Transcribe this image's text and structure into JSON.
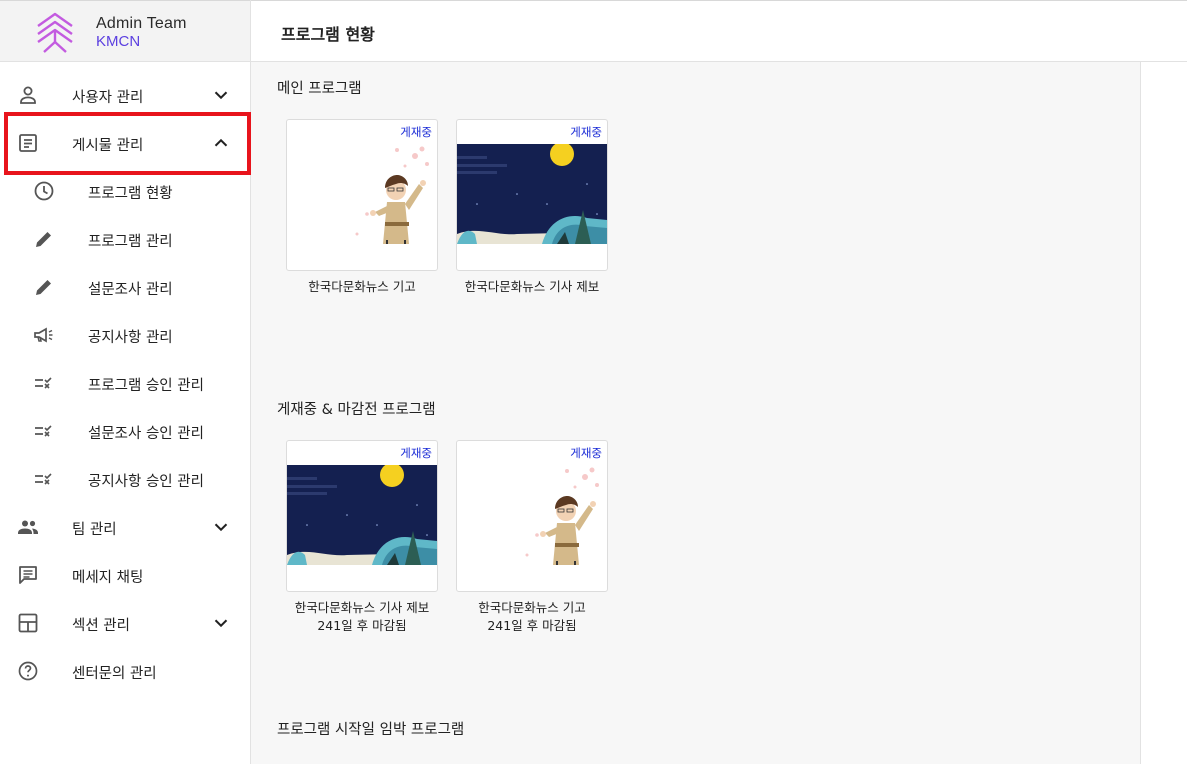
{
  "brand": {
    "line1": "Admin Team",
    "line2": "KMCN"
  },
  "header": {
    "title": "프로그램 현황"
  },
  "sidebar": {
    "items": [
      {
        "label": "사용자 관리",
        "icon": "person-icon",
        "chevron": "down"
      },
      {
        "label": "게시물 관리",
        "icon": "article-icon",
        "chevron": "up",
        "highlighted": true
      },
      {
        "label": "프로그램 현황",
        "icon": "clock-icon"
      },
      {
        "label": "프로그램 관리",
        "icon": "pencil-icon"
      },
      {
        "label": "설문조사 관리",
        "icon": "pencil-icon"
      },
      {
        "label": "공지사항 관리",
        "icon": "megaphone-icon"
      },
      {
        "label": "프로그램 승인 관리",
        "icon": "checklist-icon"
      },
      {
        "label": "설문조사 승인 관리",
        "icon": "checklist-icon"
      },
      {
        "label": "공지사항 승인 관리",
        "icon": "checklist-icon"
      },
      {
        "label": "팀 관리",
        "icon": "group-icon",
        "chevron": "down"
      },
      {
        "label": "메세지 채팅",
        "icon": "chat-icon"
      },
      {
        "label": "섹션 관리",
        "icon": "layout-icon",
        "chevron": "down"
      },
      {
        "label": "센터문의 관리",
        "icon": "help-icon"
      }
    ]
  },
  "sections": {
    "main": {
      "title": "메인 프로그램",
      "cards": [
        {
          "badge": "게재중",
          "art": "character-illustration",
          "caption": "한국다문화뉴스 기고"
        },
        {
          "badge": "게재중",
          "art": "night-moon-illustration",
          "caption": "한국다문화뉴스 기사 제보"
        }
      ]
    },
    "open": {
      "title": "게재중 & 마감전 프로그램",
      "cards": [
        {
          "badge": "게재중",
          "art": "night-moon-illustration",
          "caption": "한국다문화뉴스 기사 제보",
          "sub": "241일 후 마감됨"
        },
        {
          "badge": "게재중",
          "art": "character-illustration",
          "caption": "한국다문화뉴스 기고",
          "sub": "241일 후 마감됨"
        }
      ]
    },
    "upcoming": {
      "title": "프로그램 시작일 임박 프로그램"
    }
  },
  "colors": {
    "accent": "#5b3fe0",
    "badge": "#1a2bd6",
    "highlight": "#e8141c",
    "night": "#142050",
    "moon": "#f5d020"
  }
}
